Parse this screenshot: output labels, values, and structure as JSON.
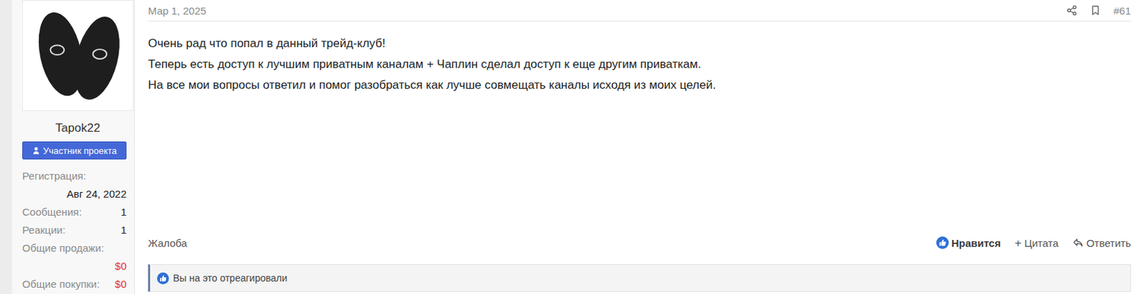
{
  "user": {
    "name": "Tapok22",
    "badge": "Участник проекта",
    "stats": [
      {
        "label": "Регистрация:",
        "value": "Авг 24, 2022",
        "kind": "stacked",
        "color": "#222222"
      },
      {
        "label": "Сообщения:",
        "value": "1",
        "kind": "inline",
        "color": "#222222"
      },
      {
        "label": "Реакции:",
        "value": "1",
        "kind": "inline",
        "color": "#222222"
      },
      {
        "label": "Общие продажи:",
        "value": "$0",
        "kind": "stacked",
        "color": "#e03131"
      },
      {
        "label": "Общие покупки:",
        "value": "$0",
        "kind": "inline",
        "color": "#e03131"
      }
    ]
  },
  "post": {
    "date": "Мар 1, 2025",
    "number": "#61",
    "lines": [
      "Очень рад что попал в данный трейд-клуб!",
      "Теперь есть доступ к лучшим приватным каналам + Чаплин сделал доступ к еще другим приваткам.",
      "На все мои вопросы ответил и помог разобраться как лучше совмещать каналы исходя из моих целей."
    ]
  },
  "footer": {
    "report": "Жалоба",
    "actions": [
      {
        "label": "Нравится",
        "kind": "like",
        "icon": "",
        "selected": true
      },
      {
        "label": "Цитата",
        "kind": "quote",
        "icon": "+",
        "selected": false
      },
      {
        "label": "Ответить",
        "kind": "reply",
        "icon": "",
        "selected": false
      }
    ]
  },
  "reactions": {
    "text": "Вы на это отреагировали"
  }
}
